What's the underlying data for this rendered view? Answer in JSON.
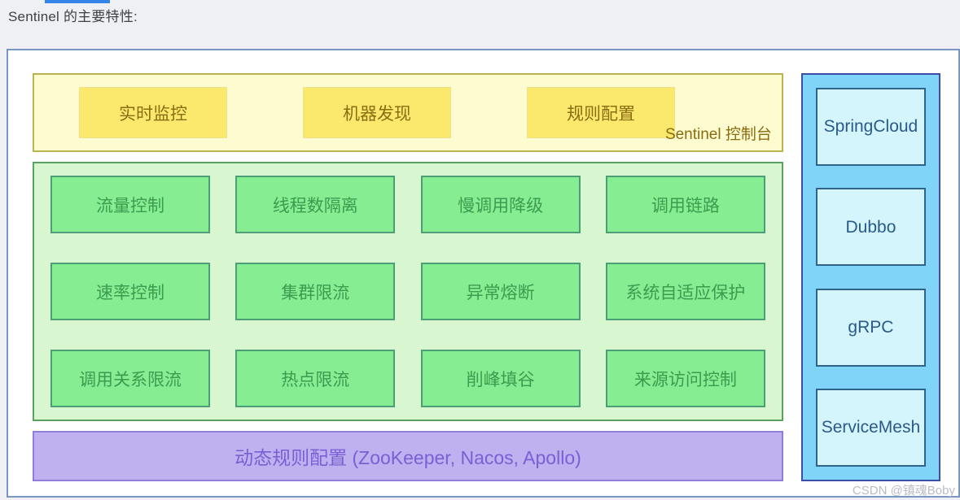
{
  "page": {
    "caption": "Sentinel 的主要特性:",
    "watermark": "CSDN @镇魂Boby"
  },
  "console_panel": {
    "label": "Sentinel 控制台",
    "boxes": [
      {
        "label": "实时监控"
      },
      {
        "label": "机器发现"
      },
      {
        "label": "规则配置"
      }
    ]
  },
  "feature_panel": {
    "rows": [
      [
        {
          "label": "流量控制"
        },
        {
          "label": "线程数隔离"
        },
        {
          "label": "慢调用降级"
        },
        {
          "label": "调用链路"
        }
      ],
      [
        {
          "label": "速率控制"
        },
        {
          "label": "集群限流"
        },
        {
          "label": "异常熔断"
        },
        {
          "label": "系统自适应保护"
        }
      ],
      [
        {
          "label": "调用关系限流"
        },
        {
          "label": "热点限流"
        },
        {
          "label": "削峰填谷"
        },
        {
          "label": "来源访问控制"
        }
      ]
    ]
  },
  "rules_bar": {
    "label": "动态规则配置 (ZooKeeper, Nacos, Apollo)"
  },
  "adapters": {
    "items": [
      {
        "line1": "Spring",
        "line2": "Cloud"
      },
      {
        "line1": "Dubbo",
        "line2": ""
      },
      {
        "line1": "gRPC",
        "line2": ""
      },
      {
        "line1": "Service",
        "line2": "Mesh"
      }
    ]
  },
  "colors": {
    "page_bg": "#eef0f4",
    "frame_border": "#7a96c2",
    "top_bar": "#3385e8",
    "console_bg": "#fdfbd0",
    "console_border": "#b9b44f",
    "console_box_bg": "#fbe96e",
    "console_text": "#8a6d10",
    "feature_bg": "#d8f6cf",
    "feature_border": "#5aa35f",
    "feature_box_bg": "#86ed92",
    "feature_box_border": "#4c9e76",
    "feature_text": "#3d9b4f",
    "rules_bg": "#bfb0f0",
    "rules_border": "#8f7ddb",
    "rules_text": "#7b5fd4",
    "adapter_col_bg": "#7fd4f7",
    "adapter_col_border": "#3b4fa8",
    "adapter_box_bg": "#d4f5fc",
    "adapter_box_border": "#2f6389",
    "adapter_text": "#2a5a8a"
  }
}
